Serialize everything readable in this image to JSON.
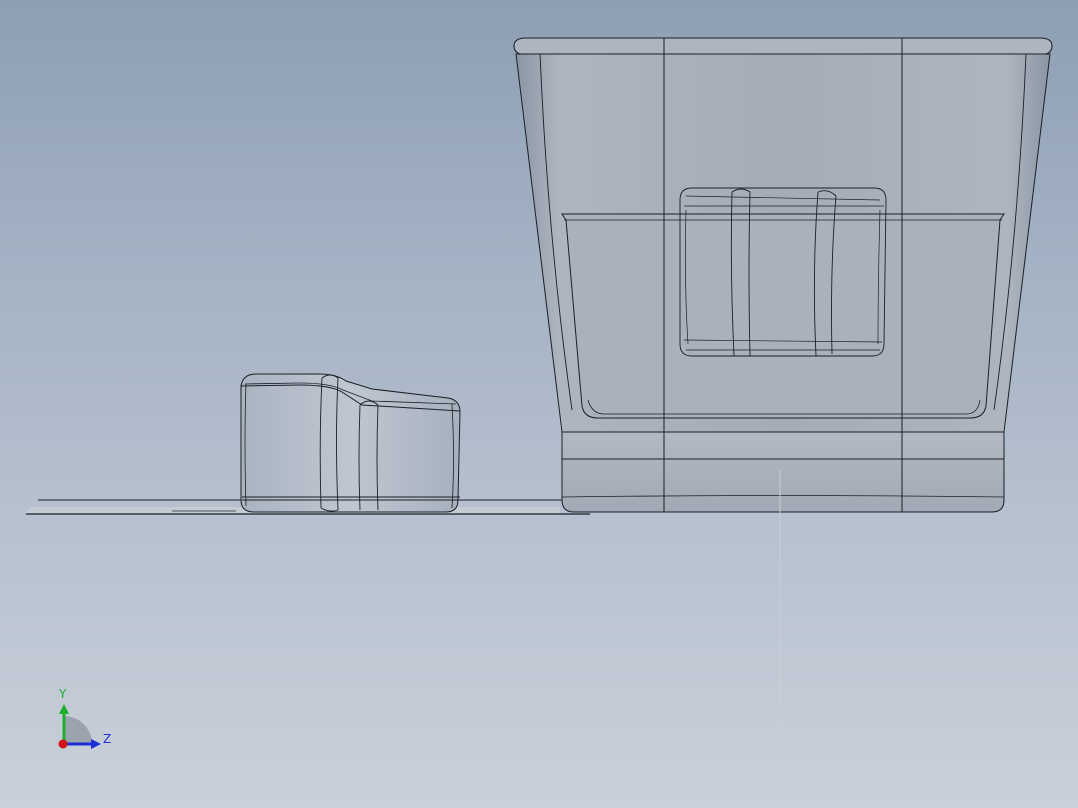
{
  "viewport": {
    "background_top": "#8e9fb4",
    "background_bottom": "#c9d0da",
    "edge_color": "#1b1f26",
    "body_fill": "#a3acb7",
    "body_shade": "#8c96a3"
  },
  "triad": {
    "y_label": "Y",
    "z_label": "Z",
    "y_color": "#1fae2e",
    "z_color": "#1c2fd6",
    "x_color": "#d4141a"
  }
}
